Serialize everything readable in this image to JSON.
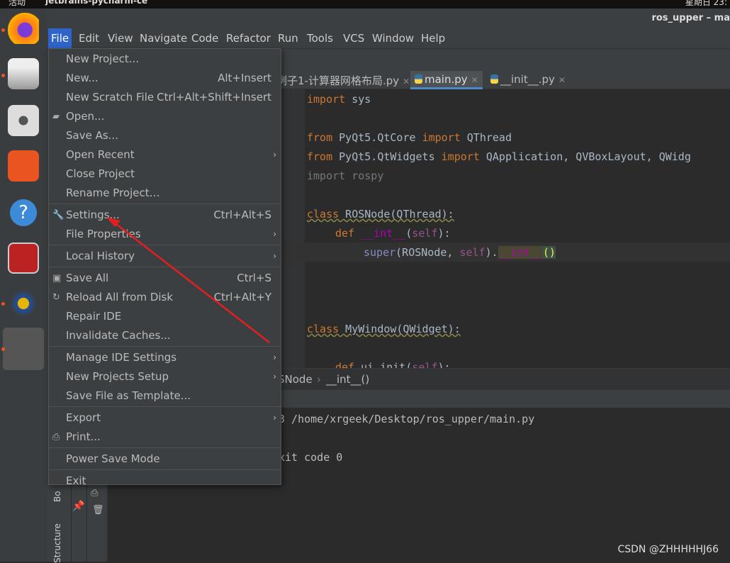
{
  "topbar": {
    "activities": "活动",
    "app_name": "jetbrains-pycharm-ce",
    "clock": "星期日 23:"
  },
  "window_title": "ros_upper – ma",
  "menubar": [
    "File",
    "Edit",
    "View",
    "Navigate",
    "Code",
    "Refactor",
    "Run",
    "Tools",
    "VCS",
    "Window",
    "Help"
  ],
  "tabs": [
    {
      "label": "例子1-计算器网格布局.py",
      "selected": false
    },
    {
      "label": "main.py",
      "selected": true
    },
    {
      "label": "__init__.py",
      "selected": false
    }
  ],
  "code": {
    "l1": [
      "import",
      " sys"
    ],
    "l2": [
      "from",
      " PyQt5.QtCore ",
      "import",
      " QThread"
    ],
    "l3": [
      "from",
      " PyQt5.QtWidgets ",
      "import",
      " QApplication, QVBoxLayout, QWidg"
    ],
    "l4": "import rospy",
    "l5": [
      "class",
      " ROSNode(QThread):"
    ],
    "l6": [
      "def ",
      "__int__",
      "(",
      "self",
      "):"
    ],
    "l7": [
      "super",
      "(ROSNode, ",
      "self",
      ").",
      "__int__",
      "()"
    ],
    "l8": [
      "class",
      " MyWindow(QWidget):"
    ],
    "l9": [
      "def ",
      "ui_init(",
      "self",
      "):"
    ]
  },
  "breadcrumb": [
    "SNode",
    "__int__()"
  ],
  "console": {
    "line1": "3 /home/xrgeek/Desktop/ros_upper/main.py",
    "line2": "xit code 0"
  },
  "side_labels": {
    "bookmarks": "Bo",
    "structure": "Structure"
  },
  "file_menu": [
    {
      "label": "New Project...",
      "shortcut": ""
    },
    {
      "label": "New...",
      "shortcut": "Alt+Insert"
    },
    {
      "label": "New Scratch File",
      "shortcut": "Ctrl+Alt+Shift+Insert"
    },
    {
      "label": "Open...",
      "shortcut": "",
      "icon": "folder-icon"
    },
    {
      "label": "Save As...",
      "shortcut": ""
    },
    {
      "label": "Open Recent",
      "shortcut": "",
      "submenu": true
    },
    {
      "label": "Close Project",
      "shortcut": ""
    },
    {
      "label": "Rename Project…",
      "shortcut": ""
    },
    {
      "label": "Settings...",
      "shortcut": "Ctrl+Alt+S",
      "icon": "wrench-icon"
    },
    {
      "label": "File Properties",
      "shortcut": "",
      "submenu": true
    },
    {
      "label": "Local History",
      "shortcut": "",
      "submenu": true
    },
    {
      "label": "Save All",
      "shortcut": "Ctrl+S",
      "icon": "save-icon"
    },
    {
      "label": "Reload All from Disk",
      "shortcut": "Ctrl+Alt+Y",
      "icon": "reload-icon"
    },
    {
      "label": "Repair IDE",
      "shortcut": ""
    },
    {
      "label": "Invalidate Caches...",
      "shortcut": ""
    },
    {
      "label": "Manage IDE Settings",
      "shortcut": "",
      "submenu": true
    },
    {
      "label": "New Projects Setup",
      "shortcut": "",
      "submenu": true
    },
    {
      "label": "Save File as Template...",
      "shortcut": ""
    },
    {
      "label": "Export",
      "shortcut": "",
      "submenu": true
    },
    {
      "label": "Print...",
      "shortcut": "",
      "icon": "print-icon"
    },
    {
      "label": "Power Save Mode",
      "shortcut": ""
    },
    {
      "label": "Exit",
      "shortcut": ""
    }
  ],
  "annotation_color": "#e02020",
  "watermark": "CSDN @ZHHHHHJ66"
}
